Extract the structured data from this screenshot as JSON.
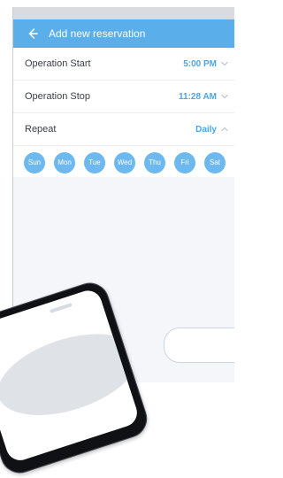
{
  "app_bar": {
    "title": "Add new reservation"
  },
  "settings": [
    {
      "label": "Operation Start",
      "value": "5:00 PM"
    },
    {
      "label": "Operation Stop",
      "value": "11:28 AM"
    },
    {
      "label": "Repeat",
      "value": "Daily"
    }
  ],
  "days": [
    "Sun",
    "Mon",
    "Tue",
    "Wed",
    "Thu",
    "Fri",
    "Sat"
  ],
  "colors": {
    "accent": "#5aaeea",
    "day_chip": "#6db8ee",
    "value_text": "#4aa6e6"
  },
  "icons": {
    "back": "arrow-left-icon",
    "chevron": "chevron-down-icon",
    "chevron_up": "chevron-up-icon"
  }
}
